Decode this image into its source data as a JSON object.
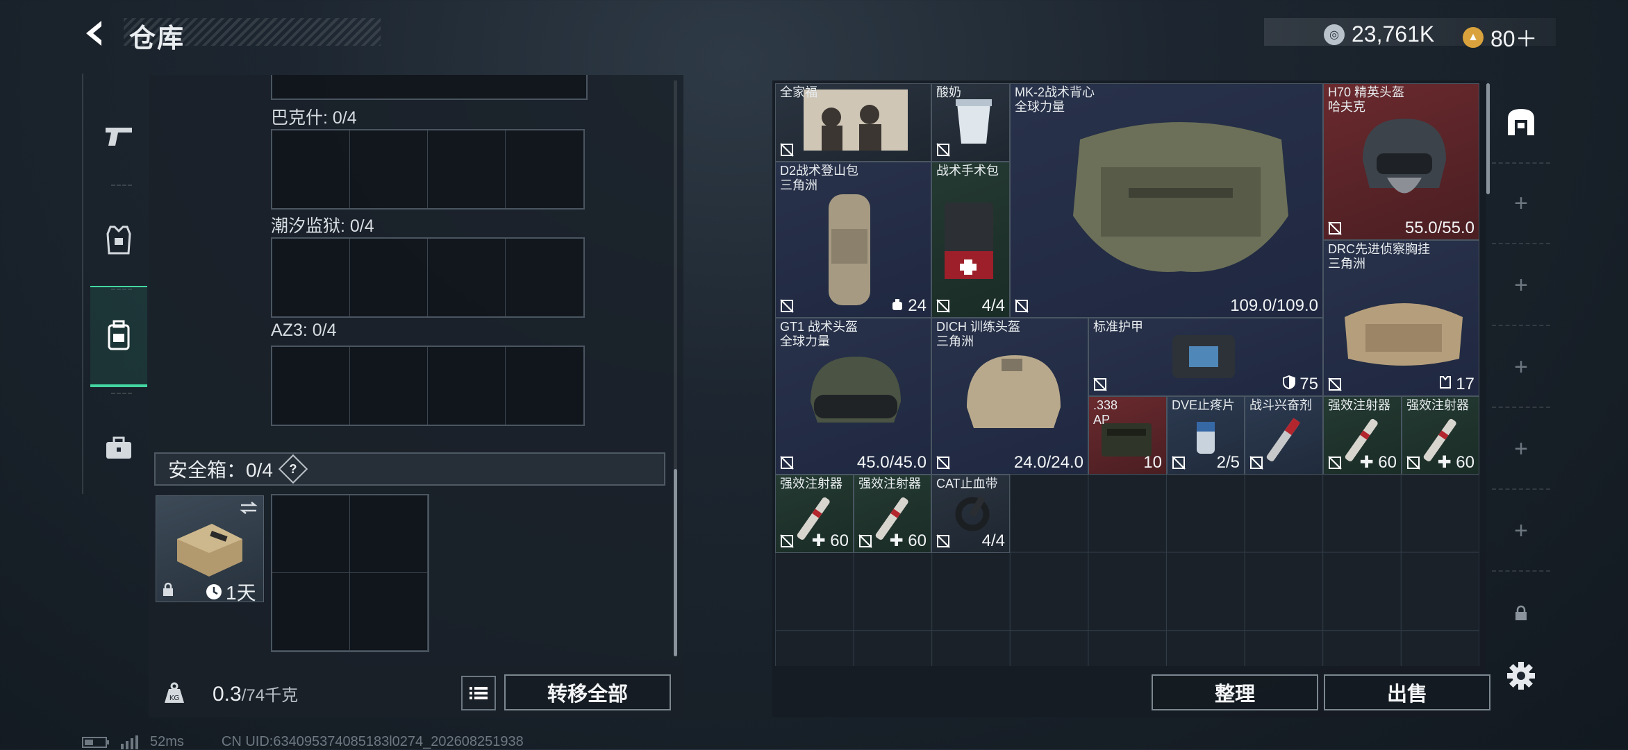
{
  "header": {
    "title": "仓库",
    "currency_1": "23,761K",
    "currency_2": "80＋"
  },
  "left": {
    "slots": [
      {
        "label": "巴克什: 0/4"
      },
      {
        "label": "潮汐监狱: 0/4"
      },
      {
        "label": "AZ3: 0/4"
      }
    ],
    "safe_box": {
      "label": "安全箱：0/4",
      "help": "?",
      "timer": "1天"
    },
    "weight": {
      "current": "0.3",
      "max": "/74千克"
    },
    "transfer_all": "转移全部"
  },
  "inventory": {
    "items": [
      {
        "name": "全家福",
        "sub": "",
        "value": ""
      },
      {
        "name": "酸奶",
        "sub": "",
        "value": ""
      },
      {
        "name": "MK-2战术背心",
        "sub": "全球力量",
        "value": "109.0/109.0"
      },
      {
        "name": "H70 精英头盔",
        "sub": "哈夫克",
        "value": "55.0/55.0"
      },
      {
        "name": "D2战术登山包",
        "sub": "三角洲",
        "value": "24"
      },
      {
        "name": "战术手术包",
        "sub": "",
        "value": "4/4"
      },
      {
        "name": "DRC先进侦察胸挂",
        "sub": "三角洲",
        "value": "17"
      },
      {
        "name": "GT1 战术头盔",
        "sub": "全球力量",
        "value": "45.0/45.0"
      },
      {
        "name": "DICH 训练头盔",
        "sub": "三角洲",
        "value": "24.0/24.0"
      },
      {
        "name": "标准护甲",
        "sub": "",
        "value": "75"
      },
      {
        "name": ".338",
        "sub": "AP",
        "value": "10"
      },
      {
        "name": "DVE止疼片",
        "sub": "",
        "value": "2/5"
      },
      {
        "name": "战斗兴奋剂",
        "sub": "",
        "value": ""
      },
      {
        "name": "强效注射器",
        "sub": "",
        "value": "60"
      },
      {
        "name": "强效注射器",
        "sub": "",
        "value": "60"
      },
      {
        "name": "强效注射器",
        "sub": "",
        "value": "60"
      },
      {
        "name": "强效注射器",
        "sub": "",
        "value": "60"
      },
      {
        "name": "CAT止血带",
        "sub": "",
        "value": "4/4"
      }
    ],
    "sort": "整理",
    "sell": "出售"
  },
  "status": {
    "ping": "52ms",
    "uid": "CN UID:634095374085183l0274_202608251938"
  }
}
